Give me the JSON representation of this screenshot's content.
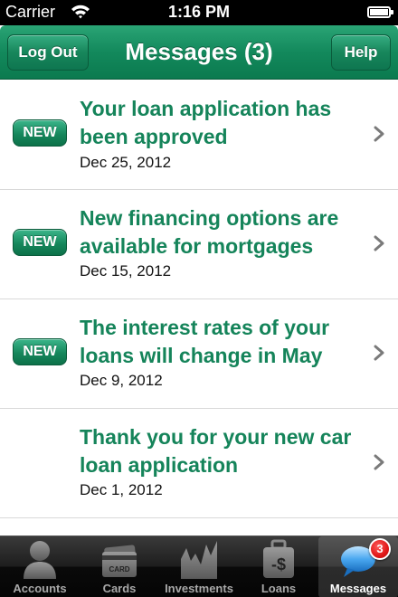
{
  "status_bar": {
    "carrier": "Carrier",
    "time": "1:16 PM"
  },
  "nav": {
    "title": "Messages (3)",
    "left_button": "Log Out",
    "right_button": "Help"
  },
  "messages": [
    {
      "badge": "NEW",
      "title": "Your loan application has been approved",
      "date": "Dec 25, 2012"
    },
    {
      "badge": "NEW",
      "title": "New financing options are available for mortgages",
      "date": "Dec 15, 2012"
    },
    {
      "badge": "NEW",
      "title": "The interest rates of your loans will change in May",
      "date": "Dec 9, 2012"
    },
    {
      "badge": "",
      "title": "Thank you for your  new car loan application",
      "date": "Dec 1, 2012"
    }
  ],
  "tabs": [
    {
      "label": "Accounts",
      "icon": "person-icon"
    },
    {
      "label": "Cards",
      "icon": "card-icon",
      "icon_text": "CARD"
    },
    {
      "label": "Investments",
      "icon": "chart-icon"
    },
    {
      "label": "Loans",
      "icon": "money-bag-icon",
      "icon_text": "-$"
    },
    {
      "label": "Messages",
      "icon": "speech-bubble-icon",
      "badge": "3",
      "active": true
    }
  ],
  "colors": {
    "brand_green": "#15845a",
    "nav_green": "#13895c",
    "badge_red": "#e01818"
  }
}
